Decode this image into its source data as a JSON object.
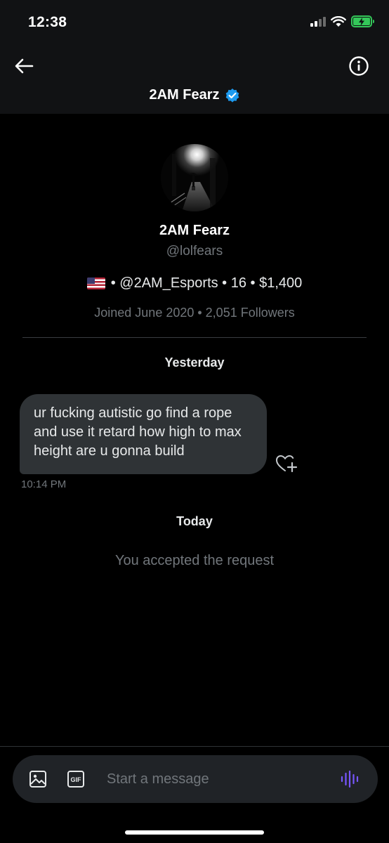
{
  "status_bar": {
    "time": "12:38",
    "battery_color": "#34c759"
  },
  "header": {
    "back_icon": "arrow-left-icon",
    "info_icon": "info-icon",
    "title": "2AM Fearz",
    "verified_color": "#1d9bf0"
  },
  "profile": {
    "name": "2AM Fearz",
    "handle": "@lolfears",
    "bio_flag": "us-flag-icon",
    "bio_text": "• @2AM_Esports • 16 • $1,400",
    "meta": "Joined June 2020 • 2,051 Followers"
  },
  "conversation": {
    "day_1": "Yesterday",
    "message_text": "ur fucking autistic go find a rope and use it retard how high to max height are u gonna build",
    "message_time": "10:14 PM",
    "react_icon": "heart-plus-icon",
    "day_2": "Today",
    "system_message": "You accepted the request"
  },
  "composer": {
    "image_icon": "image-icon",
    "gif_icon": "gif-icon",
    "gif_label": "GIF",
    "placeholder": "Start a message",
    "voice_icon": "voice-waveform-icon",
    "accent_color": "#7856ff"
  }
}
